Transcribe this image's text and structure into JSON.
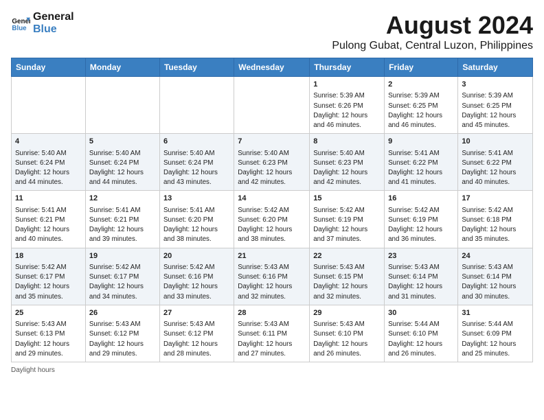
{
  "header": {
    "logo_line1": "General",
    "logo_line2": "Blue",
    "title": "August 2024",
    "subtitle": "Pulong Gubat, Central Luzon, Philippines"
  },
  "days_of_week": [
    "Sunday",
    "Monday",
    "Tuesday",
    "Wednesday",
    "Thursday",
    "Friday",
    "Saturday"
  ],
  "weeks": [
    [
      {
        "day": "",
        "info": ""
      },
      {
        "day": "",
        "info": ""
      },
      {
        "day": "",
        "info": ""
      },
      {
        "day": "",
        "info": ""
      },
      {
        "day": "1",
        "info": "Sunrise: 5:39 AM\nSunset: 6:26 PM\nDaylight: 12 hours\nand 46 minutes."
      },
      {
        "day": "2",
        "info": "Sunrise: 5:39 AM\nSunset: 6:25 PM\nDaylight: 12 hours\nand 46 minutes."
      },
      {
        "day": "3",
        "info": "Sunrise: 5:39 AM\nSunset: 6:25 PM\nDaylight: 12 hours\nand 45 minutes."
      }
    ],
    [
      {
        "day": "4",
        "info": "Sunrise: 5:40 AM\nSunset: 6:24 PM\nDaylight: 12 hours\nand 44 minutes."
      },
      {
        "day": "5",
        "info": "Sunrise: 5:40 AM\nSunset: 6:24 PM\nDaylight: 12 hours\nand 44 minutes."
      },
      {
        "day": "6",
        "info": "Sunrise: 5:40 AM\nSunset: 6:24 PM\nDaylight: 12 hours\nand 43 minutes."
      },
      {
        "day": "7",
        "info": "Sunrise: 5:40 AM\nSunset: 6:23 PM\nDaylight: 12 hours\nand 42 minutes."
      },
      {
        "day": "8",
        "info": "Sunrise: 5:40 AM\nSunset: 6:23 PM\nDaylight: 12 hours\nand 42 minutes."
      },
      {
        "day": "9",
        "info": "Sunrise: 5:41 AM\nSunset: 6:22 PM\nDaylight: 12 hours\nand 41 minutes."
      },
      {
        "day": "10",
        "info": "Sunrise: 5:41 AM\nSunset: 6:22 PM\nDaylight: 12 hours\nand 40 minutes."
      }
    ],
    [
      {
        "day": "11",
        "info": "Sunrise: 5:41 AM\nSunset: 6:21 PM\nDaylight: 12 hours\nand 40 minutes."
      },
      {
        "day": "12",
        "info": "Sunrise: 5:41 AM\nSunset: 6:21 PM\nDaylight: 12 hours\nand 39 minutes."
      },
      {
        "day": "13",
        "info": "Sunrise: 5:41 AM\nSunset: 6:20 PM\nDaylight: 12 hours\nand 38 minutes."
      },
      {
        "day": "14",
        "info": "Sunrise: 5:42 AM\nSunset: 6:20 PM\nDaylight: 12 hours\nand 38 minutes."
      },
      {
        "day": "15",
        "info": "Sunrise: 5:42 AM\nSunset: 6:19 PM\nDaylight: 12 hours\nand 37 minutes."
      },
      {
        "day": "16",
        "info": "Sunrise: 5:42 AM\nSunset: 6:19 PM\nDaylight: 12 hours\nand 36 minutes."
      },
      {
        "day": "17",
        "info": "Sunrise: 5:42 AM\nSunset: 6:18 PM\nDaylight: 12 hours\nand 35 minutes."
      }
    ],
    [
      {
        "day": "18",
        "info": "Sunrise: 5:42 AM\nSunset: 6:17 PM\nDaylight: 12 hours\nand 35 minutes."
      },
      {
        "day": "19",
        "info": "Sunrise: 5:42 AM\nSunset: 6:17 PM\nDaylight: 12 hours\nand 34 minutes."
      },
      {
        "day": "20",
        "info": "Sunrise: 5:42 AM\nSunset: 6:16 PM\nDaylight: 12 hours\nand 33 minutes."
      },
      {
        "day": "21",
        "info": "Sunrise: 5:43 AM\nSunset: 6:16 PM\nDaylight: 12 hours\nand 32 minutes."
      },
      {
        "day": "22",
        "info": "Sunrise: 5:43 AM\nSunset: 6:15 PM\nDaylight: 12 hours\nand 32 minutes."
      },
      {
        "day": "23",
        "info": "Sunrise: 5:43 AM\nSunset: 6:14 PM\nDaylight: 12 hours\nand 31 minutes."
      },
      {
        "day": "24",
        "info": "Sunrise: 5:43 AM\nSunset: 6:14 PM\nDaylight: 12 hours\nand 30 minutes."
      }
    ],
    [
      {
        "day": "25",
        "info": "Sunrise: 5:43 AM\nSunset: 6:13 PM\nDaylight: 12 hours\nand 29 minutes."
      },
      {
        "day": "26",
        "info": "Sunrise: 5:43 AM\nSunset: 6:12 PM\nDaylight: 12 hours\nand 29 minutes."
      },
      {
        "day": "27",
        "info": "Sunrise: 5:43 AM\nSunset: 6:12 PM\nDaylight: 12 hours\nand 28 minutes."
      },
      {
        "day": "28",
        "info": "Sunrise: 5:43 AM\nSunset: 6:11 PM\nDaylight: 12 hours\nand 27 minutes."
      },
      {
        "day": "29",
        "info": "Sunrise: 5:43 AM\nSunset: 6:10 PM\nDaylight: 12 hours\nand 26 minutes."
      },
      {
        "day": "30",
        "info": "Sunrise: 5:44 AM\nSunset: 6:10 PM\nDaylight: 12 hours\nand 26 minutes."
      },
      {
        "day": "31",
        "info": "Sunrise: 5:44 AM\nSunset: 6:09 PM\nDaylight: 12 hours\nand 25 minutes."
      }
    ]
  ],
  "footer": "Daylight hours"
}
